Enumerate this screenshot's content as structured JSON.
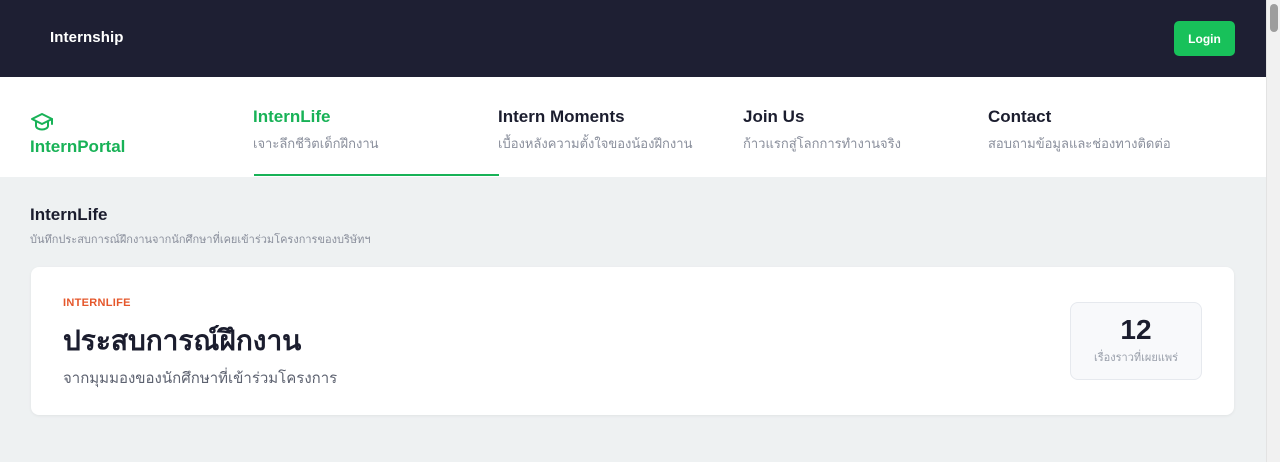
{
  "topbar": {
    "title": "Internship",
    "login_label": "Login"
  },
  "brand": {
    "name": "InternPortal",
    "icon": "graduation-cap-icon",
    "color": "#18b257"
  },
  "nav": {
    "items": [
      {
        "label": "InternLife",
        "sub": "เจาะลึกชีวิตเด็กฝึกงาน",
        "active": true
      },
      {
        "label": "Intern Moments",
        "sub": "เบื้องหลังความตั้งใจของน้องฝึกงาน",
        "active": false
      },
      {
        "label": "Join Us",
        "sub": "ก้าวแรกสู่โลกการทำงานจริง",
        "active": false
      },
      {
        "label": "Contact",
        "sub": "สอบถามข้อมูลและช่องทางติดต่อ",
        "active": false
      }
    ]
  },
  "section": {
    "title": "InternLife",
    "subtitle": "บันทึกประสบการณ์ฝึกงานจากนักศึกษาที่เคยเข้าร่วมโครงการของบริษัทฯ"
  },
  "card": {
    "eyebrow": "INTERNLIFE",
    "title": "ประสบการณ์ฝึกงาน",
    "subtitle": "จากมุมมองของนักศึกษาที่เข้าร่วมโครงการ",
    "stat_value": "12",
    "stat_label": "เรื่องราวที่เผยแพร่"
  },
  "colors": {
    "topbar_bg": "#1e1f33",
    "accent_green": "#18c15a",
    "eyebrow_orange": "#e5572b",
    "page_bg": "#eef1f2"
  }
}
